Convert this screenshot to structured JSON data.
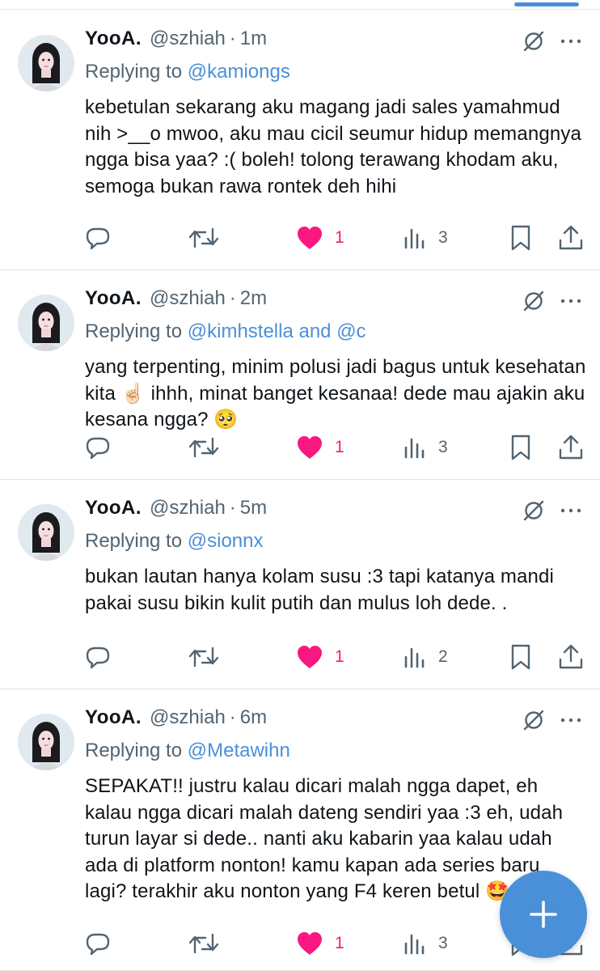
{
  "tweets": [
    {
      "name": "YooA.",
      "handle": "@szhiah",
      "separator": "·",
      "time": "1m",
      "replying_prefix": "Replying to",
      "replying_to": "@kamiongs",
      "text": "kebetulan sekarang aku magang jadi sales yamahmud nih >__o mwoo, aku mau cicil seumur hidup memangnya ngga bisa yaa? :( boleh! tolong terawang khodam aku, semoga bukan rawa rontek deh hihi",
      "likes": "1",
      "views": "3"
    },
    {
      "name": "YooA.",
      "handle": "@szhiah",
      "separator": "·",
      "time": "2m",
      "replying_prefix": "Replying to",
      "replying_to": "@kimhstella and @c",
      "text": "yang terpenting, minim polusi jadi bagus untuk kesehatan kita ☝🏻 ihhh, minat banget kesanaa! dede mau ajakin aku kesana ngga? 🥺",
      "likes": "1",
      "views": "3"
    },
    {
      "name": "YooA.",
      "handle": "@szhiah",
      "separator": "·",
      "time": "5m",
      "replying_prefix": "Replying to",
      "replying_to": "@sionnx",
      "text": "bukan lautan hanya kolam susu :3 tapi katanya mandi pakai susu bikin kulit putih dan mulus loh dede. .",
      "likes": "1",
      "views": "2"
    },
    {
      "name": "YooA.",
      "handle": "@szhiah",
      "separator": "·",
      "time": "6m",
      "replying_prefix": "Replying to",
      "replying_to": "@Metawihn",
      "text": "SEPAKAT!! justru kalau dicari malah ngga dapet, eh kalau ngga dicari malah dateng sendiri yaa :3 eh, udah turun layar si dede.. nanti aku kabarin yaa kalau udah ada di platform nonton! kamu kapan ada series baru lagi? terakhir aku nonton yang F4 keren betul 🤩",
      "likes": "1",
      "views": "3"
    }
  ],
  "icons": {
    "reply": "reply-icon",
    "retweet": "retweet-icon",
    "like": "heart-icon",
    "views": "views-icon",
    "bookmark": "bookmark-icon",
    "share": "share-icon",
    "mute": "mute-conversation-icon",
    "more": "more-icon",
    "compose": "plus-icon"
  },
  "colors": {
    "accent": "#4a90d9",
    "like": "#f91880",
    "secondary_text": "#536471",
    "text": "#0f1419"
  }
}
